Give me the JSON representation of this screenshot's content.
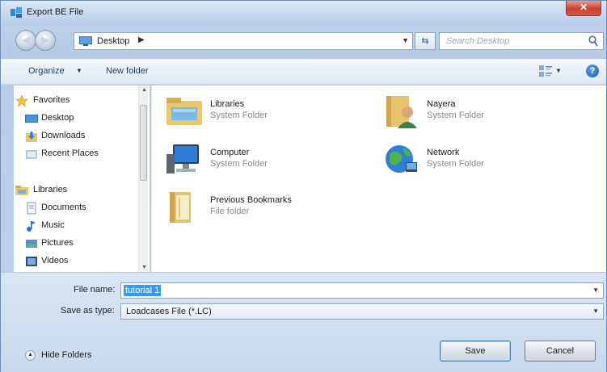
{
  "window": {
    "title": "Export BE File"
  },
  "address": {
    "location": "Desktop",
    "search_placeholder": "Search Desktop"
  },
  "toolbar": {
    "organize_label": "Organize",
    "new_folder_label": "New folder"
  },
  "nav_pane": {
    "items": [
      {
        "label": "Favorites",
        "icon": "star-icon"
      },
      {
        "label": "Desktop",
        "icon": "desktop-icon"
      },
      {
        "label": "Downloads",
        "icon": "downloads-icon"
      },
      {
        "label": "Recent Places",
        "icon": "recent-places-icon"
      },
      {
        "label": "Libraries",
        "icon": "libraries-icon"
      },
      {
        "label": "Documents",
        "icon": "documents-icon"
      },
      {
        "label": "Music",
        "icon": "music-icon"
      },
      {
        "label": "Pictures",
        "icon": "pictures-icon"
      },
      {
        "label": "Videos",
        "icon": "videos-icon"
      }
    ]
  },
  "content": {
    "items": [
      {
        "name": "Libraries",
        "type": "System Folder",
        "icon": "libraries-folder-icon"
      },
      {
        "name": "Nayera",
        "type": "System Folder",
        "icon": "user-folder-icon"
      },
      {
        "name": "Computer",
        "type": "System Folder",
        "icon": "computer-icon"
      },
      {
        "name": "Network",
        "type": "System Folder",
        "icon": "network-icon"
      },
      {
        "name": "Previous Bookmarks",
        "type": "File folder",
        "icon": "folder-icon"
      }
    ]
  },
  "form": {
    "file_name_label": "File name:",
    "file_name_value": "tutorial 1",
    "save_type_label": "Save as type:",
    "save_type_value": "Loadcases File (*.LC)"
  },
  "footer": {
    "hide_folders_label": "Hide Folders",
    "save_label": "Save",
    "cancel_label": "Cancel"
  },
  "colors": {
    "selection": "#3399ff",
    "title_gradient_top": "#dbe7f6",
    "close_red": "#c9412d"
  }
}
